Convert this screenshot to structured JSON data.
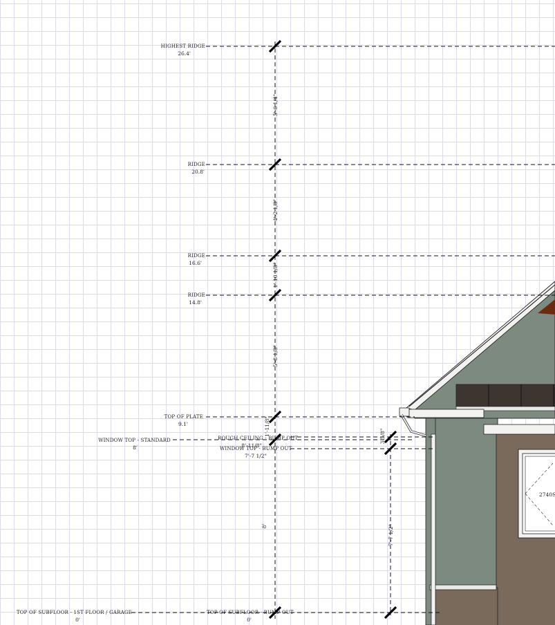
{
  "levels": {
    "highest_ridge": {
      "name": "HIGHEST RIDGE",
      "value": "26.4'"
    },
    "ridge_1": {
      "name": "RIDGE",
      "value": "20.8'"
    },
    "ridge_2": {
      "name": "RIDGE",
      "value": "16.6'"
    },
    "ridge_3": {
      "name": "RIDGE",
      "value": "14.8'"
    },
    "top_of_plate": {
      "name": "TOP OF PLATE",
      "value": "9.1'"
    },
    "window_top_standard": {
      "name": "WINDOW TOP - STANDARD",
      "value": "8'"
    },
    "rough_ceiling_bump_out": {
      "name": "ROUGH CEILING - BUMP OUT",
      "value": "8'-11/8\""
    },
    "window_top_bump_out": {
      "name": "WINDOW TOP - BUMP OUT",
      "value": "7'-7 1/2\""
    },
    "subfloor_garage": {
      "name": "TOP OF SUBFLOOR - 1ST FLOOR / GARAGE",
      "value": "0'"
    },
    "subfloor_bump_out": {
      "name": "TOP OF SUBFLOOR - BUMP OUT",
      "value": "0'"
    }
  },
  "dimensions": {
    "d1": "5'-6 1/4\"",
    "d2": "4'-2 1/8\"",
    "d3": "1'-10 1/8\"",
    "d4": "5'-8 1/8\"",
    "d5": "1'-11/8\"",
    "d6": "8'",
    "d7": "3 5/8\"",
    "d8": "7'-7 1/2\""
  },
  "window_label": "2740S",
  "colors": {
    "siding_green": "#7d8a80",
    "siding_brown": "#7a6a5c",
    "soffit_dark": "#3d3530",
    "fascia_brown": "#6b2b12",
    "trim": "#f2f2f0"
  }
}
